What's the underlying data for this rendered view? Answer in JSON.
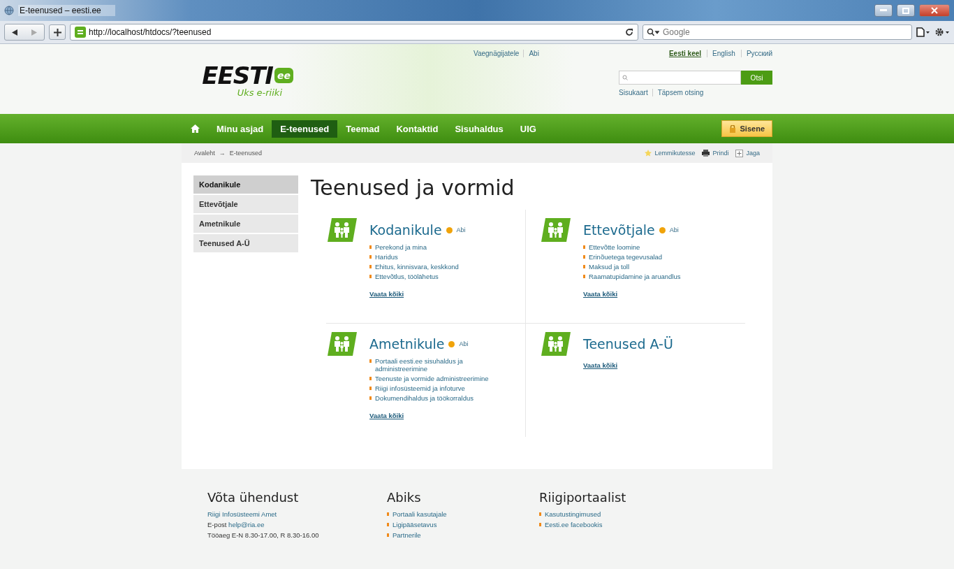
{
  "window": {
    "title": "E-teenused – eesti.ee"
  },
  "toolbar": {
    "url": "http://localhost/htdocs/?teenused",
    "search": {
      "placeholder": "Google"
    }
  },
  "header": {
    "logo_text": "EESTI",
    "logo_badge": "ee",
    "tagline": "Uks e-riiki",
    "top_links": [
      {
        "label": "Vaegnägijatele"
      },
      {
        "label": "Abi"
      }
    ],
    "languages": [
      {
        "label": "Eesti keel",
        "selected": true
      },
      {
        "label": "English",
        "selected": false
      },
      {
        "label": "Русский",
        "selected": false
      }
    ],
    "search": {
      "button": "Otsi"
    },
    "search_links": [
      {
        "label": "Sisukaart"
      },
      {
        "label": "Täpsem otsing"
      }
    ]
  },
  "nav": {
    "items": [
      {
        "label": "Minu asjad",
        "selected": false
      },
      {
        "label": "E-teenused",
        "selected": true
      },
      {
        "label": "Teemad",
        "selected": false
      },
      {
        "label": "Kontaktid",
        "selected": false
      },
      {
        "label": "Sisuhaldus",
        "selected": false
      },
      {
        "label": "UIG",
        "selected": false
      }
    ],
    "login": "Sisene"
  },
  "breadcrumb": {
    "items": [
      "Avaleht",
      "E-teenused"
    ],
    "separator": "→",
    "actions": [
      {
        "label": "Lemmikutesse",
        "kind": "star"
      },
      {
        "label": "Prindi",
        "kind": "print"
      },
      {
        "label": "Jaga",
        "kind": "share"
      }
    ]
  },
  "sidebar": {
    "items": [
      {
        "label": "Kodanikule",
        "selected": true
      },
      {
        "label": "Ettevõtjale",
        "selected": false
      },
      {
        "label": "Ametnikule",
        "selected": false
      },
      {
        "label": "Teenused A-Ü",
        "selected": false
      }
    ]
  },
  "page_title": "Teenused ja vormid",
  "sections": [
    {
      "title": "Kodanikule",
      "help": "Abi",
      "links": [
        "Perekond ja mina",
        "Haridus",
        "Ehitus, kinnisvara, keskkond",
        "Ettevõtlus, töölähetus"
      ],
      "more": "Vaata kõiki"
    },
    {
      "title": "Ettevõtjale",
      "help": "Abi",
      "links": [
        "Ettevõtte loomine",
        "Erinõuetega tegevusalad",
        "Maksud ja toll",
        "Raamatupidamine ja aruandlus"
      ],
      "more": "Vaata kõiki"
    },
    {
      "title": "Ametnikule",
      "help": "Abi",
      "links": [
        "Portaali eesti.ee sisuhaldus ja administreerimine",
        "Teenuste ja vormide administreerimine",
        "Riigi infosüsteemid ja infoturve",
        "Dokumendihaldus ja töökorraldus"
      ],
      "more": "Vaata kõiki"
    },
    {
      "title": "Teenused A-Ü",
      "more": "Vaata kõiki"
    }
  ],
  "footer": {
    "columns": [
      {
        "kind": "contact",
        "title": "Võta ühendust",
        "org": "Riigi Infosüsteemi Amet",
        "email_label": "E-post",
        "email": "help@ria.ee",
        "hours": "Tööaeg E-N 8.30-17.00, R 8.30-16.00"
      },
      {
        "kind": "links",
        "title": "Abiks",
        "links": [
          "Portaali kasutajale",
          "Ligipääsetavus",
          "Partnerile"
        ]
      },
      {
        "kind": "links",
        "title": "Riigiportaalist",
        "links": [
          "Kasutustingimused",
          "Eesti.ee facebookis"
        ]
      }
    ]
  }
}
